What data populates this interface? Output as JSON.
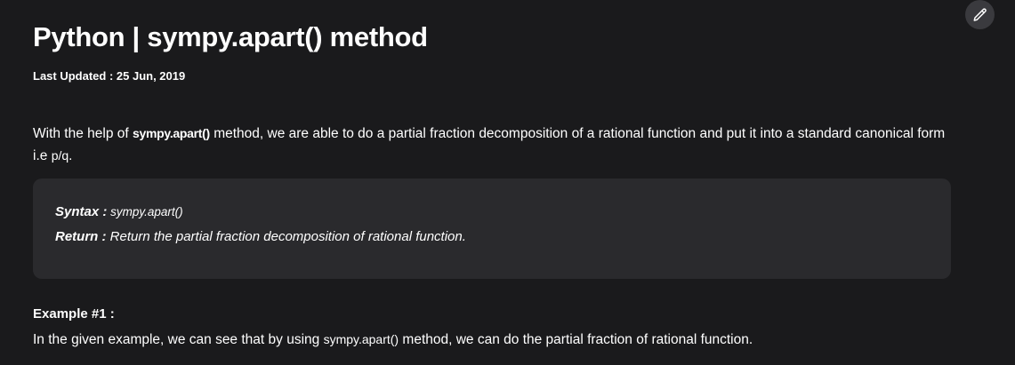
{
  "article": {
    "title": "Python | sympy.apart() method",
    "last_updated": "Last Updated : 25 Jun, 2019",
    "intro": {
      "part1": "With the help of ",
      "code": "sympy.apart()",
      "part2": " method, we are able to do a partial fraction decomposition of a rational function and put it into a standard canonical form i.e ",
      "code2": "p/q",
      "part3": "."
    },
    "syntax_box": {
      "syntax_label": "Syntax :",
      "syntax_value": " sympy.apart()",
      "return_label": "Return :",
      "return_value": " Return the partial fraction decomposition of rational function."
    },
    "example": {
      "heading": "Example #1 :",
      "part1": "In the given example, we can see that by using ",
      "code": "sympy.apart()",
      "part2": " method, we can do the partial fraction of rational function."
    }
  },
  "toolbar": {
    "edit_icon": "pencil-icon"
  }
}
